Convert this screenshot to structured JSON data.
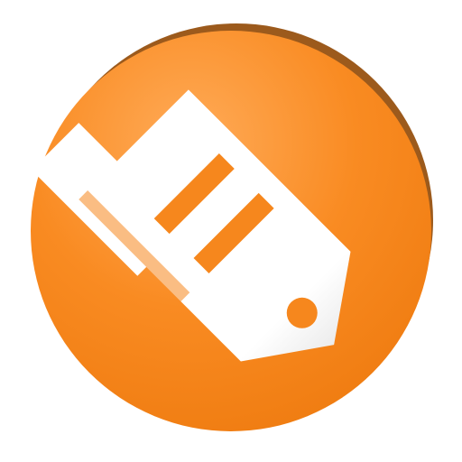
{
  "app_icon": {
    "icon_name": "document-tag-icon",
    "colors": {
      "circle_light": "#ffab58",
      "circle_mid": "#f98b22",
      "circle_dark": "#f07d12",
      "circle_rim": "#9c5a1c",
      "glyph": "#ffffff",
      "glyph_shade": "#ececec",
      "accent": "#f6871d"
    }
  }
}
